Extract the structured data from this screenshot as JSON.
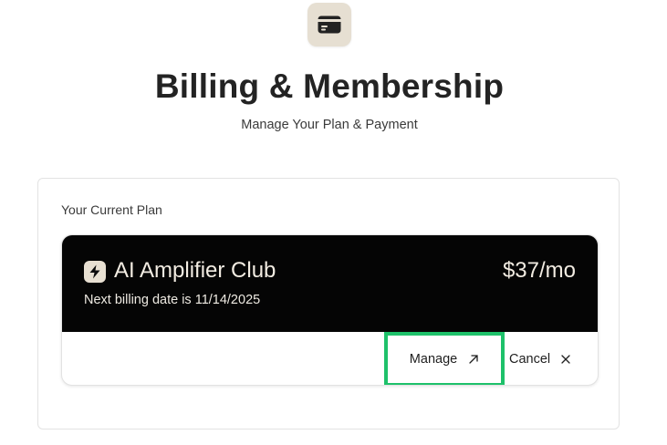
{
  "header": {
    "icon": "credit-card-icon",
    "title": "Billing & Membership",
    "subtitle": "Manage Your Plan & Payment"
  },
  "plan_panel": {
    "heading": "Your Current Plan",
    "card": {
      "icon": "lightning-bolt-icon",
      "plan_name": "AI Amplifier Club",
      "price": "$37/mo",
      "billing_text": "Next billing date is 11/14/2025",
      "manage_label": "Manage",
      "manage_icon": "external-arrow-icon",
      "cancel_label": "Cancel",
      "cancel_icon": "close-icon"
    }
  },
  "colors": {
    "card_dark": "#050505",
    "icon_badge": "#e8e0d2",
    "highlight": "#1ec16a"
  }
}
